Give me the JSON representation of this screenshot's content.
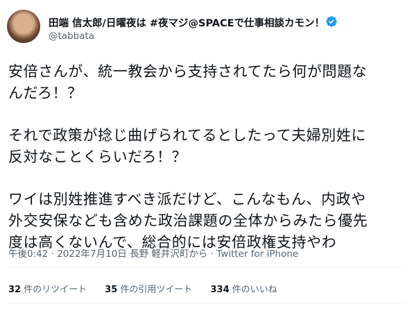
{
  "author": {
    "name": "田端 信太郎/日曜夜は #夜マジ@SPACEで仕事相談カモン！",
    "handle": "@tabbata"
  },
  "tweet": {
    "lines": [
      "安倍さんが、統一教会から支持されてたら何が問題な",
      "んだろ！？",
      "",
      "それで政策が捻じ曲げられてるとしたって夫婦別姓に",
      "反対なことくらいだろ！？",
      "",
      "ワイは別姓推進すべき派だけど、こんなもん、内政や",
      "外交安保なども含めた政治課題の全体からみたら優先",
      "度は高くないんで、総合的には安倍政権支持やわ"
    ]
  },
  "meta": {
    "text": "午後0:42 · 2022年7月10日 長野 軽井沢町から · Twitter for iPhone"
  },
  "stats": {
    "retweets": {
      "count": "32",
      "label": "件のリツイート"
    },
    "quotes": {
      "count": "35",
      "label": "件の引用ツイート"
    },
    "likes": {
      "count": "334",
      "label": "件のいいね"
    }
  },
  "colors": {
    "accent": "#1d9bf0",
    "muted": "#536471",
    "text": "#0f1419"
  }
}
